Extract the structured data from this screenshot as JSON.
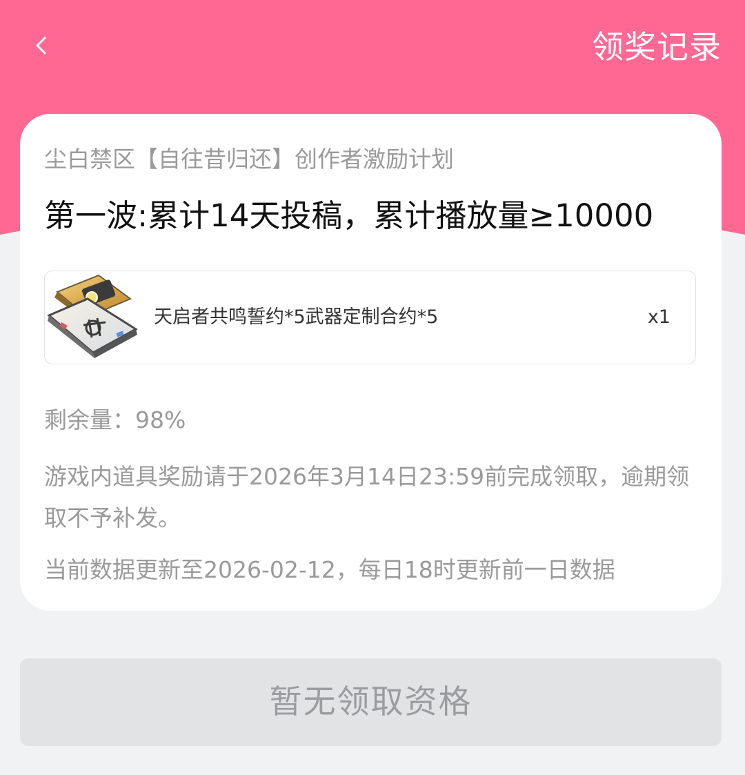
{
  "header": {
    "back_icon": "chevron-left-icon",
    "records_label": "领奖记录",
    "accent_color": "#ff6893"
  },
  "card": {
    "campaign_title": "尘白禁区【自往昔归还】创作者激励计划",
    "task_title": "第一波:累计14天投稿，累计播放量≥10000",
    "reward": {
      "thumbnail": "reward-pack-icon",
      "name": "天启者共鸣誓约*5武器定制合约*5",
      "quantity": "x1"
    },
    "remaining_text": "剩余量：98%",
    "deadline_note": "游戏内道具奖励请于2026年3月14日23:59前完成领取，逾期领取不予补发。",
    "update_note": "当前数据更新至2026-02-12，每日18时更新前一日数据"
  },
  "claim_button": {
    "label": "暂无领取资格",
    "disabled": true
  }
}
